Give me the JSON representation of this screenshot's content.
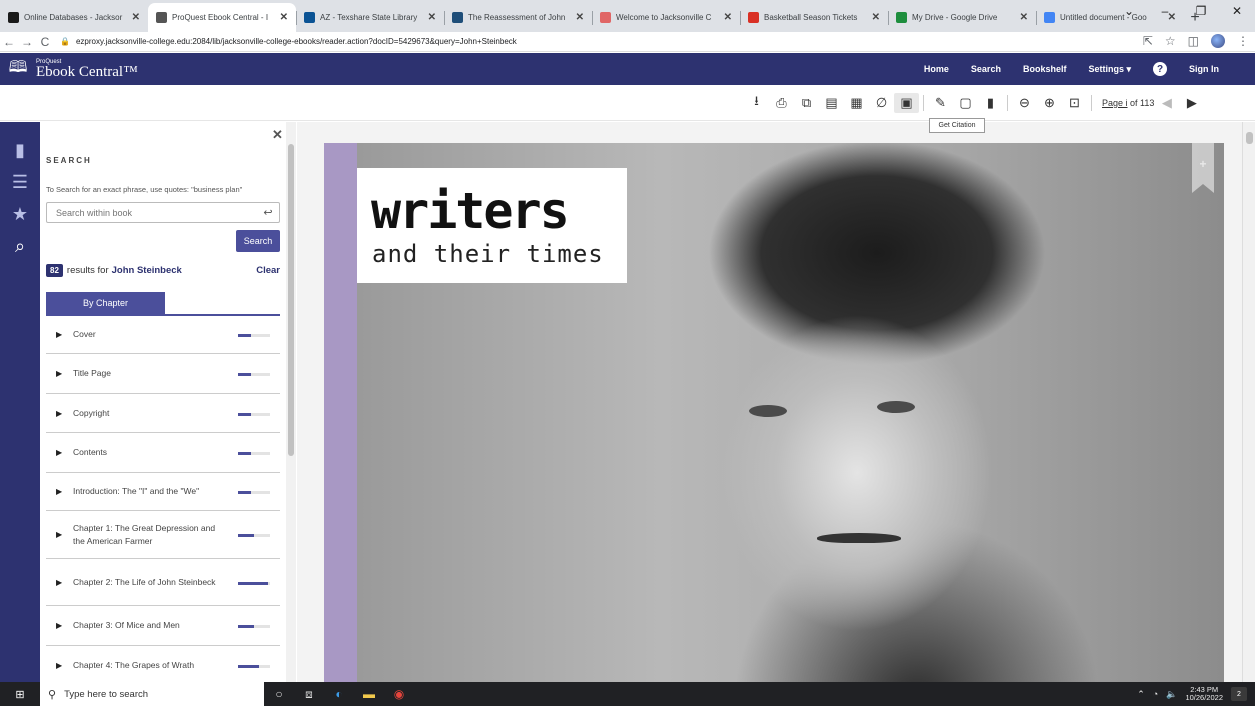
{
  "browser": {
    "tabs": [
      {
        "title": "Online Databases - Jacksor",
        "icon": "jc-logo-icon",
        "color": "#1a1a1a",
        "active": false
      },
      {
        "title": "ProQuest Ebook Central - I",
        "icon": "proquest-icon",
        "color": "#555555",
        "active": true
      },
      {
        "title": "AZ - Texshare State Library",
        "icon": "texshare-icon",
        "color": "#0b5394",
        "active": false
      },
      {
        "title": "The Reassessment of John",
        "icon": "document-icon",
        "color": "#1f4e79",
        "active": false
      },
      {
        "title": "Welcome to Jacksonville C",
        "icon": "jacksonville-icon",
        "color": "#e06666",
        "active": false
      },
      {
        "title": "Basketball Season Tickets",
        "icon": "gmail-icon",
        "color": "#d93025",
        "active": false
      },
      {
        "title": "My Drive - Google Drive",
        "icon": "drive-icon",
        "color": "#1e8e3e",
        "active": false
      },
      {
        "title": "Untitled document - Goo",
        "icon": "docs-icon",
        "color": "#4285f4",
        "active": false
      }
    ],
    "url": "ezproxy.jacksonville-college.edu:2084/lib/jacksonville-college-ebooks/reader.action?docID=5429673&query=John+Steinbeck"
  },
  "header": {
    "brand_small": "ProQuest",
    "brand_big": "Ebook Central™",
    "nav": {
      "home": "Home",
      "search": "Search",
      "bookshelf": "Bookshelf",
      "settings": "Settings ▾",
      "sign_in": "Sign In"
    }
  },
  "toolbar": {
    "page_link": "Page i",
    "page_total": " of 113",
    "tooltip": "Get Citation"
  },
  "search_panel": {
    "title": "SEARCH",
    "hint": "To Search for an exact phrase, use quotes: \"business plan\"",
    "placeholder": "Search within book",
    "button": "Search",
    "result_count": "82",
    "results_text": "results for",
    "query": "John Steinbeck",
    "clear": "Clear",
    "by_chapter": "By Chapter",
    "chapters": [
      {
        "title": "Cover",
        "relevance": 0.4
      },
      {
        "title": "Title Page",
        "relevance": 0.4
      },
      {
        "title": "Copyright",
        "relevance": 0.4
      },
      {
        "title": "Contents",
        "relevance": 0.4
      },
      {
        "title": "Introduction: The \"I\" and the \"We\"",
        "relevance": 0.4
      },
      {
        "title": "Chapter 1: The Great Depression and the American Farmer",
        "relevance": 0.5
      },
      {
        "title": "Chapter 2: The Life of John Steinbeck",
        "relevance": 0.95
      },
      {
        "title": "Chapter 3: Of Mice and Men",
        "relevance": 0.5
      },
      {
        "title": "Chapter 4: The Grapes of Wrath",
        "relevance": 0.65
      }
    ]
  },
  "book": {
    "title_word": "writers",
    "title_sub": "and their times"
  },
  "taskbar": {
    "search_placeholder": "Type here to search",
    "time": "2:43 PM",
    "date": "10/26/2022",
    "notifications": "2"
  }
}
